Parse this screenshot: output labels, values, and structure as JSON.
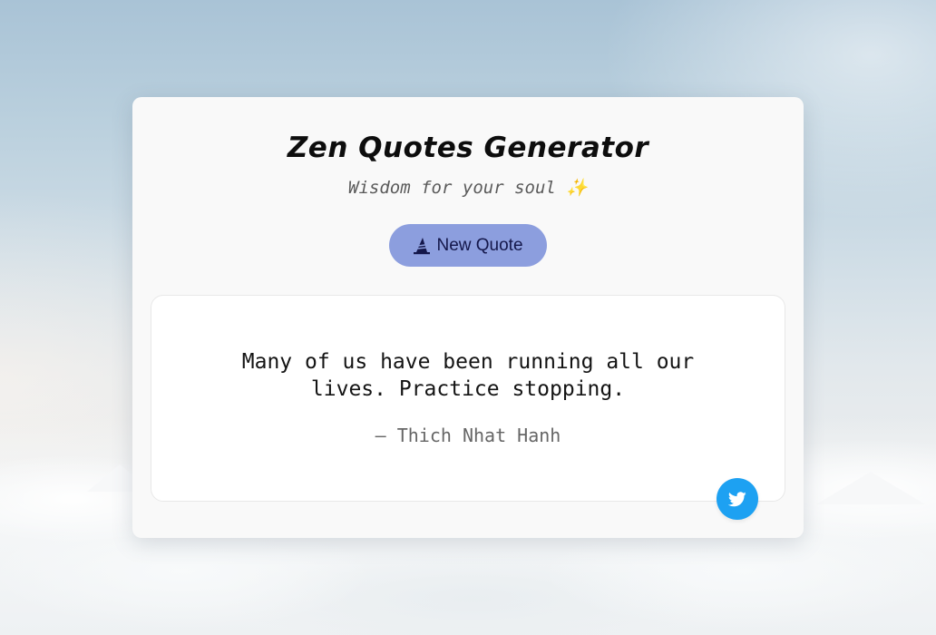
{
  "header": {
    "title": "Zen Quotes Generator",
    "subtitle": "Wisdom for your soul ✨"
  },
  "actions": {
    "new_quote_label": "New Quote",
    "new_quote_icon": "wizard-hat-icon",
    "tweet_icon": "twitter-icon"
  },
  "quote": {
    "text": "Many of us have been running all our lives. Practice stopping.",
    "author": "— Thich Nhat Hanh"
  },
  "colors": {
    "button_bg": "#8c9ede",
    "button_text": "#14174a",
    "twitter_blue": "#1da1f2",
    "card_bg": "#f9f9f9"
  }
}
